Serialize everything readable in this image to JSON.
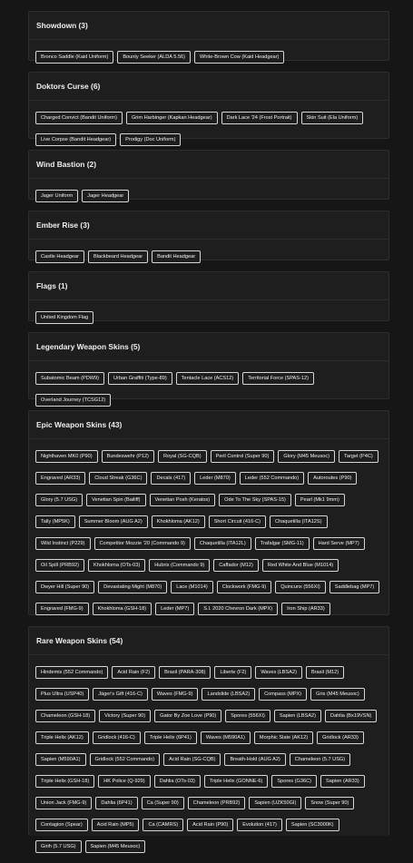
{
  "sections": [
    {
      "title": "Showdown (3)",
      "items": [
        "Bronco Saddle (Kaid Uniform)",
        "Bounty Seeker (ALDA 5.56)",
        "White-Brown Cow (Kaid Headgear)"
      ]
    },
    {
      "title": "Doktors Curse (6)",
      "items": [
        "Charged Convict (Bandit Uniform)",
        "Grim Harbinger (Kapkan Headgear)",
        "Dark Lace '24 (Frost Portrait)",
        "Skin Suit (Ela Uniform)",
        "Live Corpse (Bandit Headgear)",
        "Prodigy (Doc Uniform)"
      ]
    },
    {
      "title": "Wind Bastion (2)",
      "items": [
        "Jager Uniform",
        "Jager Headgear"
      ]
    },
    {
      "title": "Ember Rise (3)",
      "items": [
        "Castle Headgear",
        "Blackbeard Headgear",
        "Bandit Headgear"
      ]
    },
    {
      "title": "Flags (1)",
      "items": [
        "United Kingdom Flag"
      ]
    },
    {
      "title": "Legendary Weapon Skins (5)",
      "items": [
        "Subatomic Beam (PDW9)",
        "Urban Graffiti (Type-89)",
        "Tentacle Lace (ACS12)",
        "Territorial Force (SPAS-12)",
        "Overland Journey (TCSG12)"
      ]
    },
    {
      "title": "Epic Weapon Skins (43)",
      "items": [
        "Nighthaven MK0 (P90)",
        "Bundeswehr (P12)",
        "Royal (SG-CQB)",
        "Peril Control (Super 90)",
        "Glory (M45 Meusoc)",
        "Target (P4C)",
        "Engraved (AR33)",
        "Cloud Streak (G36C)",
        "Decals (417)",
        "Leder (M870)",
        "Leder (552 Commando)",
        "Autoroutes (P90)",
        "Glory (5.7 USG)",
        "Venetian Spin (Bailiff)",
        "Venetian Posh (Keratos)",
        "Ode To The Sky (SPAS-15)",
        "Pearl (Mk1 9mm)",
        "Tally (MP5K)",
        "Summer Bloom (AUG A2)",
        "Khokhloma (AK12)",
        "Short Circuit (416-C)",
        "Chaquetilla (ITA12S)",
        "Wild Instinct (P229)",
        "Competitor Mozzie '20 (Commando 9)",
        "Chaquetilla (ITA12L)",
        "Trafalgar (SMG-11)",
        "Hard Serve (MP7)",
        "Oil Spill (PRB92)",
        "Khokhloma (OTs-03)",
        "Hubris (Commando 9)",
        "Caffador (M12)",
        "Red White And Blue (M1014)",
        "Dwyer Hill (Super 90)",
        "Devastating Might (M870)",
        "Lace (M1014)",
        "Clockwork (FMG-9)",
        "Quincunx (556XI)",
        "Saddlebag (MP7)",
        "Engraved (FMG-9)",
        "Khokhloma (GSH-18)",
        "Leder (MP7)",
        "S.I. 2020 Chevron Dark (MPX)",
        "Iron Ship (AR33)"
      ]
    },
    {
      "title": "Rare Weapon Skins (54)",
      "items": [
        "Hindemis (552 Commando)",
        "Acid Rain (F2)",
        "Brasil (PARA-308)",
        "Liberte (F2)",
        "Waves (LBSA2)",
        "Brasil (M12)",
        "Plus Ultra (USP40)",
        "Jäger's Gift (416-C)",
        "Waves (FMG-9)",
        "Landslide (LBSA2)",
        "Compass (MPX)",
        "Gris (M45 Meusoc)",
        "Chameleon (GSH-18)",
        "Victory (Super 90)",
        "Gator By Zoe Love (P90)",
        "Spores (556XI)",
        "Sapien (LBSA2)",
        "Dahlia (Bx19VSN)",
        "Triple Helix (AK12)",
        "Gridlock (416-C)",
        "Triple Helix (6P41)",
        "Waves (M590A1)",
        "Morphic Slate (AK12)",
        "Gridlock (AR33)",
        "Sapien (M590A1)",
        "Gridlock (552 Commando)",
        "Acid Rain (SG-CQB)",
        "Breath-Hold (AUG A2)",
        "Chameleon (5.7 USG)",
        "Triple Helix (GSH-18)",
        "HK Police (Q-929)",
        "Dahlia (OTs-03)",
        "Triple Helix (GONNE-6)",
        "Spores (G36C)",
        "Sapien (AR33)",
        "Union Jack (FMG-9)",
        "Dahlia (6P41)",
        "Ca (Super 90)",
        "Chameleon (PRB92)",
        "Sapien (UZK50GI)",
        "Snow (Super 90)",
        "Contagion (Spear)",
        "Acid Rain (MP5)",
        "Ca (CAMRS)",
        "Acid Rain (P90)",
        "Evolution (417)",
        "Sapien (SC3000K)",
        "Girih (5.7 USG)",
        "Sapien (M45 Meusoc)"
      ]
    }
  ]
}
